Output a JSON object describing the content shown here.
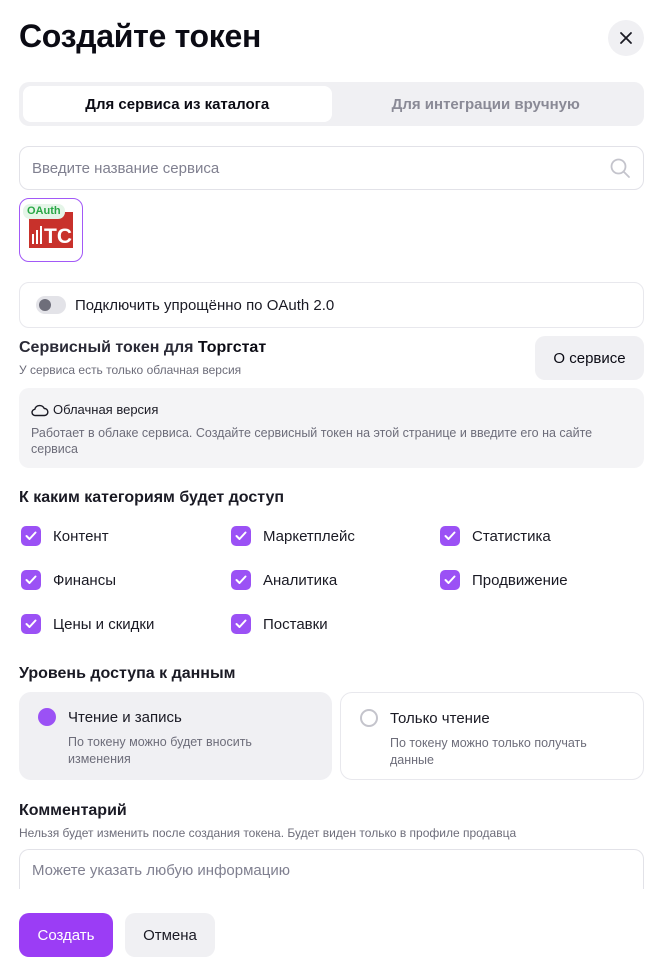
{
  "dialog": {
    "title": "Создайте токен",
    "close_icon": "close-icon"
  },
  "tabs": [
    {
      "label": "Для сервиса из каталога",
      "active": true
    },
    {
      "label": "Для интеграции вручную",
      "active": false
    }
  ],
  "search": {
    "placeholder": "Введите название сервиса",
    "value": "",
    "icon": "search-icon"
  },
  "service": {
    "badge": "OAuth",
    "logo_text": "TC",
    "logo_color": "#c8312b",
    "selected": true
  },
  "oauth": {
    "label": "Подключить упрощённо по OAuth 2.0",
    "enabled": false
  },
  "service_token": {
    "title_prefix": "Сервисный токен для ",
    "service_name": "Торгстат",
    "subtitle": "У сервиса есть только облачная версия",
    "about_button": "О сервисе"
  },
  "info": {
    "icon": "cloud-icon",
    "heading": "Облачная версия",
    "text": "Работает в облаке сервиса. Создайте сервисный токен на этой странице и введите его на сайте сервиса"
  },
  "categories": {
    "title": "К каким категориям будет доступ",
    "items": [
      {
        "label": "Контент",
        "checked": true
      },
      {
        "label": "Маркетплейс",
        "checked": true
      },
      {
        "label": "Статистика",
        "checked": true
      },
      {
        "label": "Финансы",
        "checked": true
      },
      {
        "label": "Аналитика",
        "checked": true
      },
      {
        "label": "Продвижение",
        "checked": true
      },
      {
        "label": "Цены и скидки",
        "checked": true
      },
      {
        "label": "Поставки",
        "checked": true
      }
    ]
  },
  "access": {
    "title": "Уровень доступа к данным",
    "options": [
      {
        "label": "Чтение и запись",
        "description": "По токену можно будет вносить изменения",
        "selected": true
      },
      {
        "label": "Только чтение",
        "description": "По токену можно только получать данные",
        "selected": false
      }
    ]
  },
  "comment": {
    "title": "Комментарий",
    "subtitle": "Нельзя будет изменить после создания токена. Будет виден только в профиле продавца",
    "placeholder": "Можете указать любую информацию",
    "value": ""
  },
  "actions": {
    "create": "Создать",
    "cancel": "Отмена"
  },
  "colors": {
    "accent": "#9b3df5",
    "checkbox": "#9b51f5",
    "oauth_badge": "#28a745"
  }
}
